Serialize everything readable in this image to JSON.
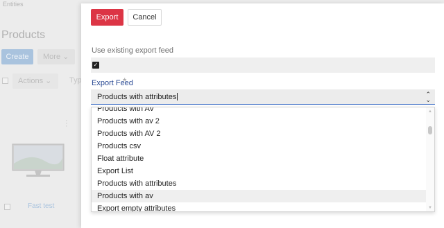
{
  "background": {
    "breadcrumb": "Entities",
    "page_title": "Products",
    "create_label": "Create",
    "more_label": "More",
    "actions_label": "Actions",
    "type_label": "Typ",
    "card_name": "Fast test"
  },
  "modal": {
    "export_label": "Export",
    "cancel_label": "Cancel",
    "use_existing_label": "Use existing export feed",
    "use_existing_checked": true,
    "export_feed_label": "Export Feed",
    "required_marker": "*",
    "selected_feed": "Products with attributes",
    "options": [
      "Products with AV",
      "Products with av 2",
      "Products with AV 2",
      "Products csv",
      "Float attribute",
      "Export List",
      "Products with attributes",
      "Products with av",
      "Export empty attributes"
    ],
    "hovered_option": "Products with av"
  },
  "colors": {
    "primary_danger": "#dc3545",
    "label_blue": "#2a4a94",
    "select_underline": "#3a6bc4"
  }
}
